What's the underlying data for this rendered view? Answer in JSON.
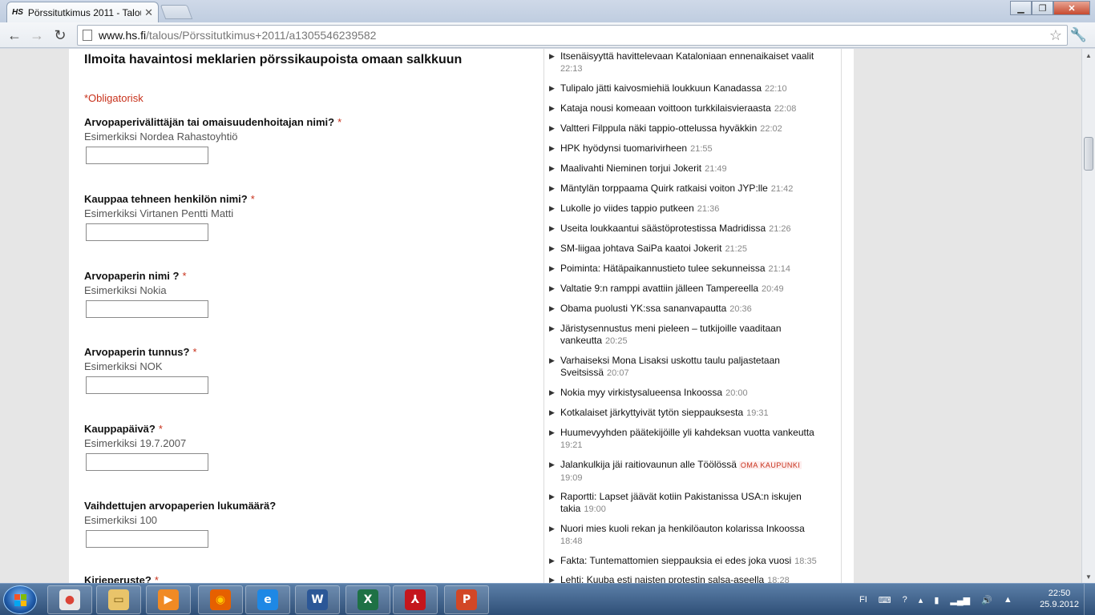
{
  "browser": {
    "tab_title": "Pörssitutkimus 2011 - Talou",
    "tab_favicon": "HS",
    "url_host": "www.hs.fi",
    "url_path": "/talous/Pörssitutkimus+2011/a1305546239582"
  },
  "form": {
    "title": "Ilmoita havaintosi meklarien pörssikaupoista omaan salkkuun",
    "obligatory": "*Obligatorisk",
    "required_marker": "*",
    "fields": [
      {
        "label": "Arvopaperivälittäjän tai omaisuudenhoitajan nimi?",
        "hint": "Esimerkiksi Nordea Rahastoyhtiö",
        "value": ""
      },
      {
        "label": "Kauppaa tehneen henkilön nimi?",
        "hint": "Esimerkiksi Virtanen Pentti Matti",
        "value": ""
      },
      {
        "label": "Arvopaperin nimi ?",
        "hint": "Esimerkiksi Nokia",
        "value": ""
      },
      {
        "label": "Arvopaperin tunnus?",
        "hint": "Esimerkiksi NOK",
        "value": ""
      },
      {
        "label": "Kauppapäivä?",
        "hint": "Esimerkiksi 19.7.2007",
        "value": ""
      },
      {
        "label": "Vaihdettujen arvopaperien lukumäärä?",
        "hint": "Esimerkiksi 100",
        "value": ""
      },
      {
        "label": "Kirjeperuste?",
        "hint": "",
        "value": ""
      }
    ]
  },
  "news": [
    {
      "title": "Itsenäisyyttä havittelevaan Kataloniaan ennenaikaiset vaalit",
      "time": "22:13"
    },
    {
      "title": "Tulipalo jätti kaivosmiehiä loukkuun Kanadassa",
      "time": "22:10"
    },
    {
      "title": "Kataja nousi komeaan voittoon turkkilaisvieraasta",
      "time": "22:08"
    },
    {
      "title": "Valtteri Filppula näki tappio-ottelussa hyväkkin",
      "time": "22:02"
    },
    {
      "title": "HPK hyödynsi tuomarivirheen",
      "time": "21:55"
    },
    {
      "title": "Maalivahti Nieminen torjui Jokerit",
      "time": "21:49"
    },
    {
      "title": "Mäntylän torppaama Quirk ratkaisi voiton JYP:lle",
      "time": "21:42"
    },
    {
      "title": "Lukolle jo viides tappio putkeen",
      "time": "21:36"
    },
    {
      "title": "Useita loukkaantui säästöprotestissa Madridissa",
      "time": "21:26"
    },
    {
      "title": "SM-liigaa johtava SaiPa kaatoi Jokerit",
      "time": "21:25"
    },
    {
      "title": "Poiminta: Hätäpaikannustieto tulee sekunneissa",
      "time": "21:14"
    },
    {
      "title": "Valtatie 9:n ramppi avattiin jälleen Tampereella",
      "time": "20:49"
    },
    {
      "title": "Obama puolusti YK:ssa sananvapautta",
      "time": "20:36"
    },
    {
      "title": "Järistysennustus meni pieleen – tutkijoille vaaditaan vankeutta",
      "time": "20:25"
    },
    {
      "title": "Varhaiseksi Mona Lisaksi uskottu taulu paljastetaan Sveitsissä",
      "time": "20:07"
    },
    {
      "title": "Nokia myy virkistysalueensa Inkoossa",
      "time": "20:00"
    },
    {
      "title": "Kotkalaiset järkyttyivät tytön sieppauksesta",
      "time": "19:31"
    },
    {
      "title": "Huumevyyhden pääteki­jöille yli kahdeksan vuotta vankeutta",
      "time": "19:21"
    },
    {
      "title": "Jalankulkija jäi raitiovaunun alle Töölössä",
      "time": "19:09",
      "tag": "OMA KAUPUNKI"
    },
    {
      "title": "Raportti: Lapset jäävät kotiin Pakistanissa USA:n iskujen takia",
      "time": "19:00"
    },
    {
      "title": "Nuori mies kuoli rekan ja henkilöauton kolarissa Inkoossa",
      "time": "18:48"
    },
    {
      "title": "Fakta: Tuntemattomien sieppauksia ei edes joka vuosi",
      "time": "18:35"
    },
    {
      "title": "Lehti: Kuuba esti naisten protestin salsa-aseella",
      "time": "18:28"
    }
  ],
  "taskbar": {
    "language": "FI",
    "time": "22:50",
    "date": "25.9.2012",
    "apps": [
      "chrome-icon",
      "explorer-folder-icon",
      "media-player-icon",
      "firefox-icon",
      "internet-explorer-icon",
      "word-icon",
      "excel-icon",
      "acrobat-icon",
      "powerpoint-icon"
    ]
  }
}
